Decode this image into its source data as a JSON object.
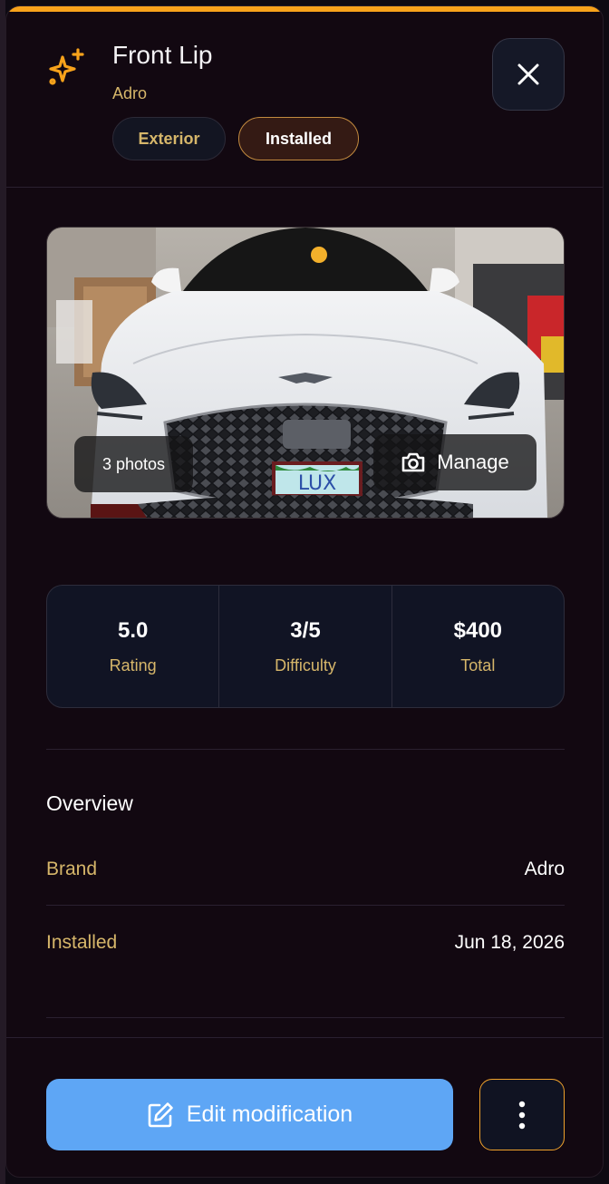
{
  "header": {
    "title": "Front Lip",
    "brand": "Adro",
    "category_chip": "Exterior",
    "status_chip": "Installed",
    "icon": "sparkle-icon",
    "close_icon": "close-icon"
  },
  "photo": {
    "count_label": "3 photos",
    "manage_label": "Manage",
    "manage_icon": "camera-icon",
    "plate_text": "LUX"
  },
  "stats": [
    {
      "value": "5.0",
      "label": "Rating"
    },
    {
      "value": "3/5",
      "label": "Difficulty"
    },
    {
      "value": "$400",
      "label": "Total"
    }
  ],
  "overview": {
    "title": "Overview",
    "rows": [
      {
        "key": "Brand",
        "value": "Adro"
      },
      {
        "key": "Installed",
        "value": "Jun 18, 2026"
      }
    ]
  },
  "footer": {
    "edit_label": "Edit modification",
    "edit_icon": "edit-icon",
    "more_icon": "more-vertical-icon"
  },
  "colors": {
    "accent": "#f7a21b",
    "gold_text": "#d6b66a",
    "primary_button": "#5ea6f5",
    "sheet_bg": "#120811"
  }
}
